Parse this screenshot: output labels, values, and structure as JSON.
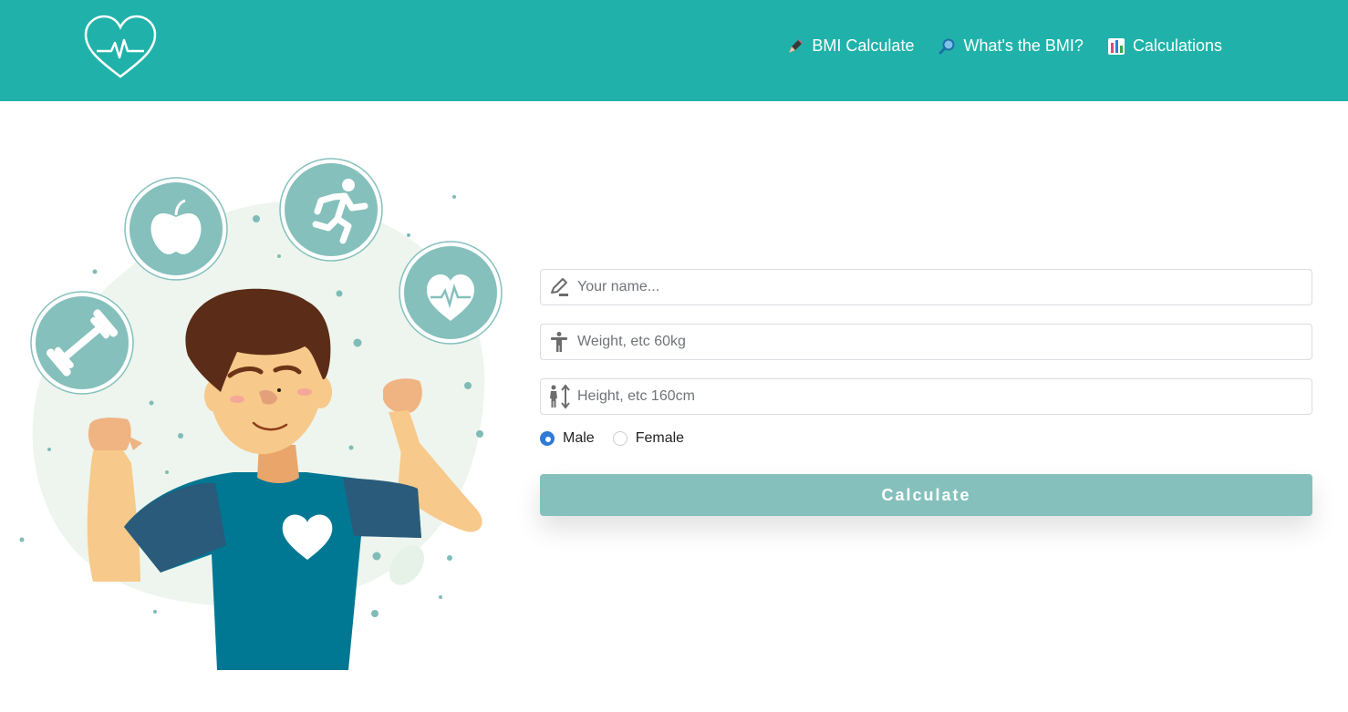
{
  "colors": {
    "header": "#20b2aa",
    "accent": "#85c0bc",
    "radio_checked": "#2f7bd6",
    "shirt": "#007793"
  },
  "header": {
    "logo_icon": "heart-pulse-icon",
    "nav": [
      {
        "icon": "pen-icon",
        "label": "BMI Calculate"
      },
      {
        "icon": "magnifier-icon",
        "label": "What's the BMI?"
      },
      {
        "icon": "bar-chart-icon",
        "label": "Calculations"
      }
    ]
  },
  "illustration": {
    "subject": "fitness-man-illustration"
  },
  "form": {
    "name": {
      "placeholder": "Your name...",
      "value": "",
      "icon": "pencil-icon"
    },
    "weight": {
      "placeholder": "Weight, etc 60kg",
      "value": "",
      "icon": "person-icon"
    },
    "height": {
      "placeholder": "Height, etc 160cm",
      "value": "",
      "icon": "height-icon"
    },
    "gender": {
      "options": [
        {
          "label": "Male",
          "checked": true
        },
        {
          "label": "Female",
          "checked": false
        }
      ]
    },
    "submit_label": "Calculate"
  }
}
